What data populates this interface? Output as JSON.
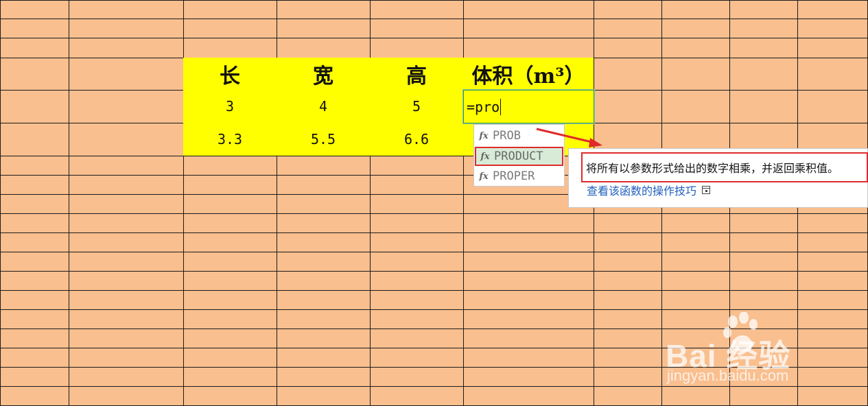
{
  "table": {
    "headers": [
      "长",
      "宽",
      "高",
      "体积（m³）"
    ],
    "rows": [
      [
        "3",
        "4",
        "5"
      ],
      [
        "3.3",
        "5.5",
        "6.6"
      ]
    ]
  },
  "formula_input": {
    "value": "=pro"
  },
  "autocomplete": {
    "items": [
      {
        "label": "PROB",
        "selected": false
      },
      {
        "label": "PRODUCT",
        "selected": true
      },
      {
        "label": "PROPER",
        "selected": false
      }
    ]
  },
  "tooltip": {
    "description": "将所有以参数形式给出的数字相乘，并返回乘积值。",
    "link": "查看该函数的操作技巧"
  },
  "watermark": {
    "brand": "Bai 经验",
    "site": "jingyan.baidu.com"
  },
  "colors": {
    "sheet_background": "#f9bf8f",
    "highlight_cells": "#ffff00",
    "annotation_red": "#e02a2a",
    "selection_green": "#2f9a55"
  }
}
